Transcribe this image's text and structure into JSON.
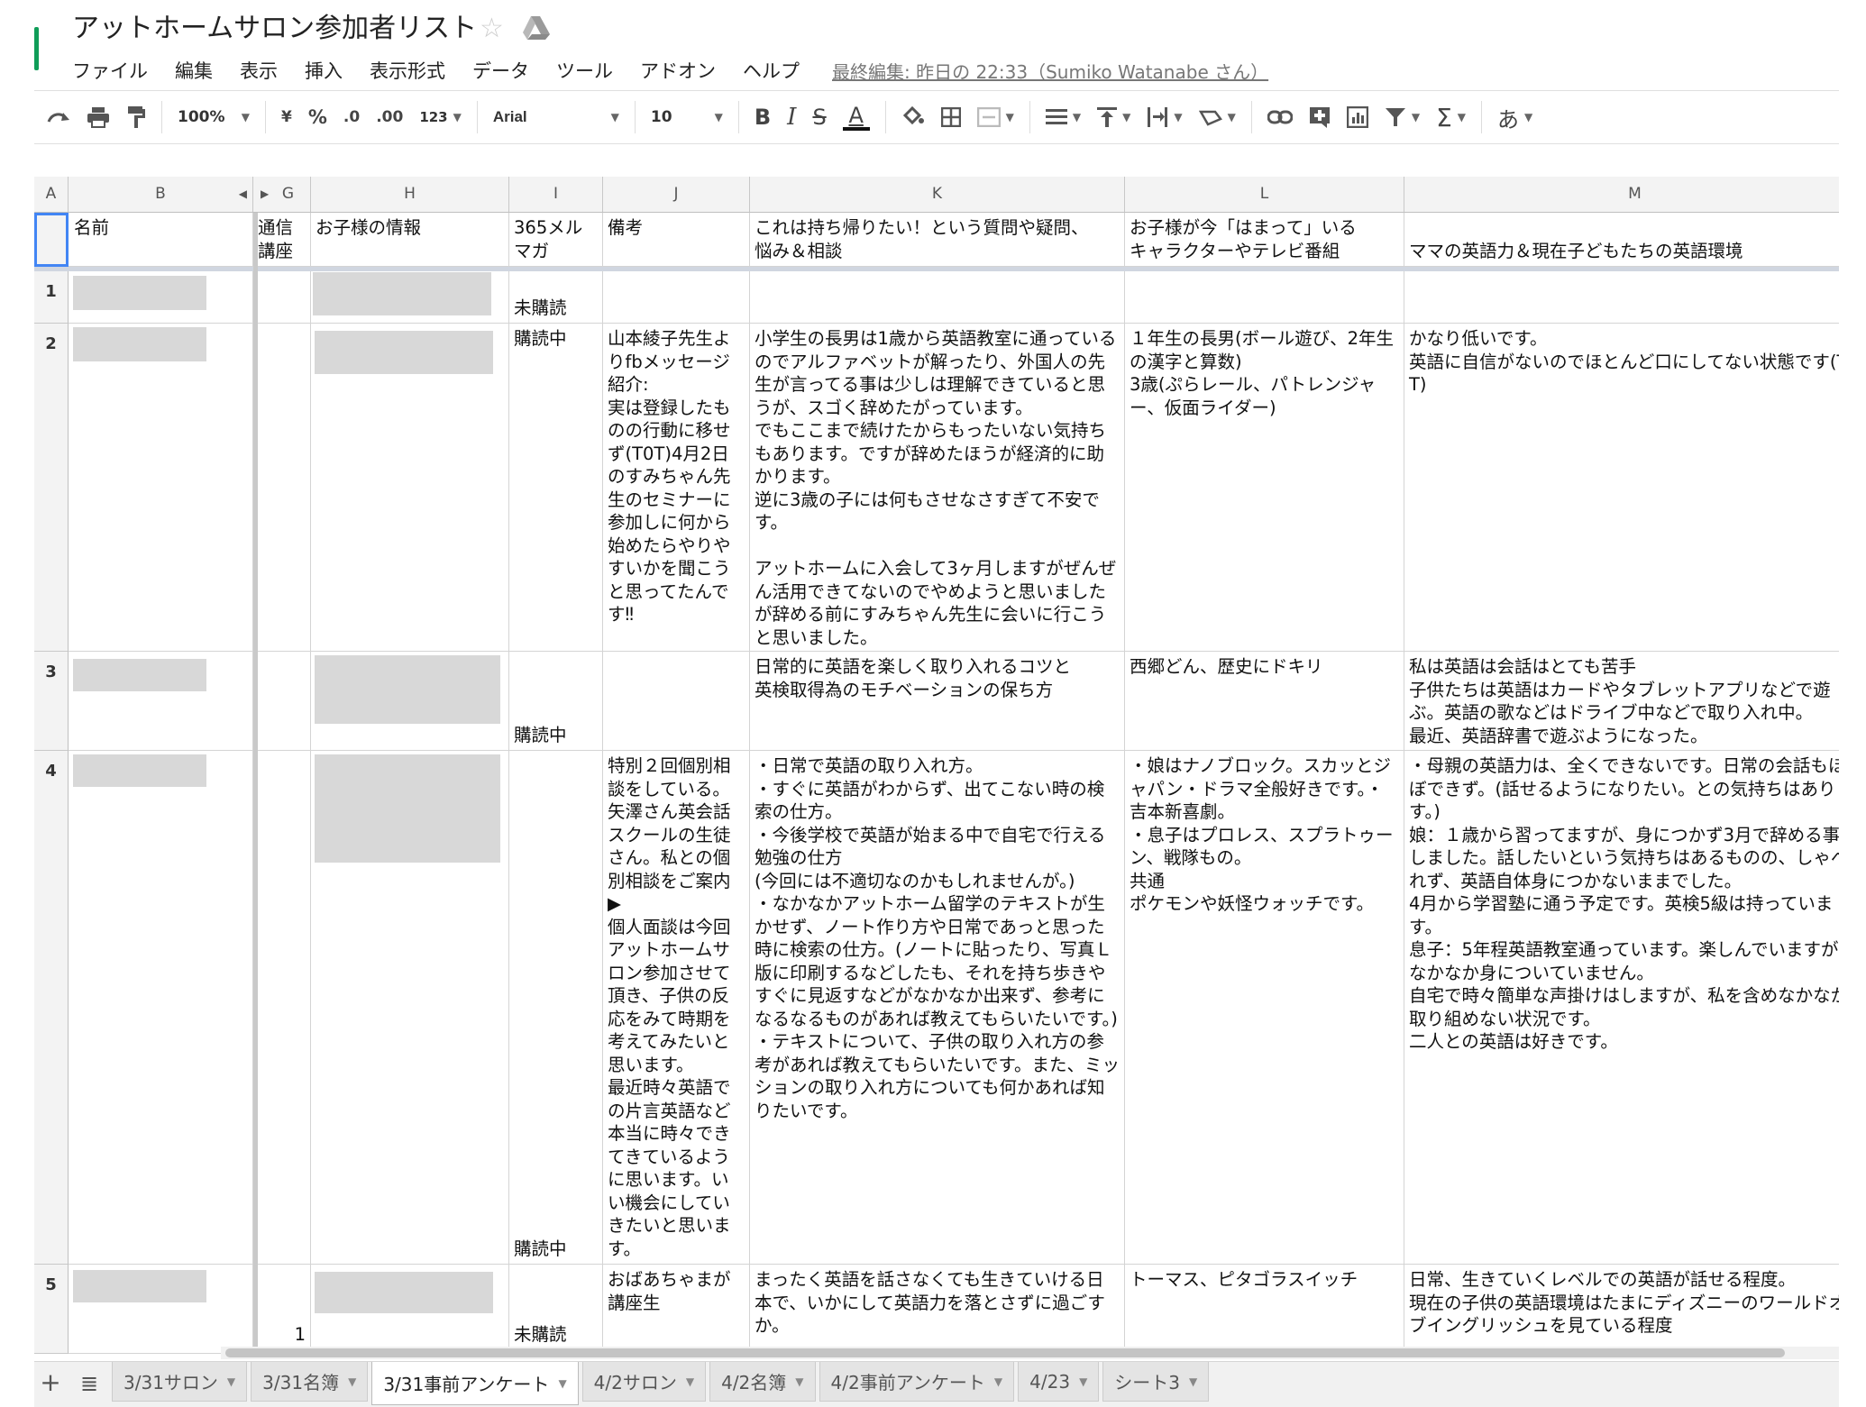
{
  "document": {
    "title": "アットホームサロン参加者リスト",
    "star_icon": "star-icon",
    "drive_icon": "drive-folder-icon",
    "brand_color": "#0f9d58"
  },
  "menu": {
    "items": [
      "ファイル",
      "編集",
      "表示",
      "挿入",
      "表示形式",
      "データ",
      "ツール",
      "アドオン",
      "ヘルプ"
    ],
    "last_edit": "最終編集: 昨日の 22:33（Sumiko Watanabe さん）"
  },
  "toolbar": {
    "zoom": "100%",
    "currency": "¥",
    "percent": "%",
    "decimal_decrease": ".0",
    "decimal_increase": ".00",
    "more_formats": "123",
    "font": "Arial",
    "font_size": "10",
    "bold": "B",
    "italic": "I",
    "strikethrough": "S",
    "text_color": "A",
    "input_tools": "あ",
    "icons": [
      "redo-icon",
      "print-icon",
      "paint-format-icon",
      "fill-color-icon",
      "borders-icon",
      "merge-cells-icon",
      "align-icon",
      "valign-icon",
      "wrap-icon",
      "rotate-icon",
      "link-icon",
      "comment-icon",
      "chart-icon",
      "filter-icon",
      "functions-icon"
    ]
  },
  "columns": [
    {
      "id": "A",
      "label": "A"
    },
    {
      "id": "B",
      "label": "B"
    },
    {
      "id": "G",
      "label": "G"
    },
    {
      "id": "H",
      "label": "H"
    },
    {
      "id": "I",
      "label": "I"
    },
    {
      "id": "J",
      "label": "J"
    },
    {
      "id": "K",
      "label": "K"
    },
    {
      "id": "L",
      "label": "L"
    },
    {
      "id": "M",
      "label": "M"
    }
  ],
  "header_row": {
    "name": "名前",
    "course": "通信\n講座",
    "child_info": "お子様の情報",
    "mailmag": "365メル\nマガ",
    "notes": "備考",
    "questions": "これは持ち帰りたい！という質問や疑問、\n悩み＆相談",
    "character": "お子様が今「はまって」いる\nキャラクターやテレビ番組",
    "english_env": "ママの英語力＆現在子どもたちの英語環境"
  },
  "rows": [
    {
      "num": "1",
      "course": "",
      "mailmag": "未購読",
      "notes": "",
      "questions": "",
      "character": "",
      "english_env": ""
    },
    {
      "num": "2",
      "course": "",
      "mailmag": "購読中",
      "notes": "山本綾子先生よりfbメッセージ紹介:\n実は登録したものの行動に移せず(T0T)4月2日のすみちゃん先生のセミナーに参加しに何から始めたらやりやすいかを聞こうと思ってたんです‼",
      "questions": "小学生の長男は1歳から英語教室に通っているのでアルファベットが解ったり、外国人の先生が言ってる事は少しは理解できていると思うが、スゴく辞めたがっています。\nでもここまで続けたからもったいない気持ちもあります。ですが辞めたほうが経済的に助かります。\n逆に3歳の子には何もさせなさすぎて不安です。\n\nアットホームに入会して3ヶ月しますがぜんぜん活用できてないのでやめようと思いましたが辞める前にすみちゃん先生に会いに行こうと思いました。",
      "character": "１年生の長男(ボール遊び、2年生の漢字と算数)\n3歳(ぷらレール、パトレンジャー、仮面ライダー)",
      "english_env": "かなり低いです。\n英語に自信がないのでほとんど口にしてない状態です(TT)"
    },
    {
      "num": "3",
      "course": "",
      "mailmag": "購読中",
      "notes": "",
      "questions": "日常的に英語を楽しく取り入れるコツと\n英検取得為のモチベーションの保ち方",
      "character": "西郷どん、歴史にドキリ",
      "english_env": "私は英語は会話はとても苦手\n子供たちは英語はカードやタブレットアプリなどで遊ぶ。英語の歌などはドライブ中などで取り入れ中。\n最近、英語辞書で遊ぶようになった。"
    },
    {
      "num": "4",
      "course": "",
      "mailmag": "購読中",
      "notes": "特別２回個別相談をしている。\n矢澤さん英会話スクールの生徒さん。私との個別相談をご案内\n▶\n個人面談は今回アットホームサロン参加させて頂き、子供の反応をみて時期を考えてみたいと思います。\n最近時々英語での片言英語など本当に時々できてきているように思います。いい機会にしていきたいと思います。",
      "questions": "・日常で英語の取り入れ方。\n・すぐに英語がわからず、出てこない時の検索の仕方。\n・今後学校で英語が始まる中で自宅で行える勉強の仕方\n(今回には不適切なのかもしれませんが。)\n・なかなかアットホーム留学のテキストが生かせず、ノート作り方や日常であっと思った時に検索の仕方。(ノートに貼ったり、写真Ｌ版に印刷するなどしたも、それを持ち歩きやすぐに見返すなどがなかなか出来ず、参考になるなるものがあれば教えてもらいたいです。)\n・テキストについて、子供の取り入れ方の参考があれば教えてもらいたいです。また、ミッションの取り入れ方についても何かあれば知りたいです。",
      "character": "・娘はナノブロック。スカッとジャパン・ドラマ全般好きです。・吉本新喜劇。\n・息子はプロレス、スプラトゥーン、戦隊もの。\n共通\nポケモンや妖怪ウォッチです。",
      "english_env": "・母親の英語力は、全くできないです。日常の会話もほぼできず。(話せるようになりたい。との気持ちはあります。)\n娘：１歳から習ってますが、身につかず3月で辞める事にしました。話したいという気持ちはあるものの、しゃべれず、英語自体身につかないままでした。\n4月から学習塾に通う予定です。英検5級は持っています。\n息子：5年程英語教室通っています。楽しんでいますが、なかなか身についていません。\n自宅で時々簡単な声掛けはしますが、私を含めなかなか取り組めない状況です。\n二人との英語は好きです。"
    },
    {
      "num": "5",
      "course": "1",
      "mailmag": "未購読",
      "notes": "おばあちゃまが講座生",
      "questions": "まったく英語を話さなくても生きていける日本で、いかにして英語力を落とさずに過ごすか。",
      "character": "トーマス、ピタゴラスイッチ",
      "english_env": "日常、生きていくレベルでの英語が話せる程度。\n現在の子供の英語環境はたまにディズニーのワールドオブイングリッシュを見ている程度"
    }
  ],
  "sheet_tabs": {
    "add_icon": "plus-icon",
    "list_icon": "sheet-list-icon",
    "tabs": [
      "3/31サロン",
      "3/31名簿",
      "3/31事前アンケート",
      "4/2サロン",
      "4/2名簿",
      "4/2事前アンケート",
      "4/23",
      "シート3"
    ],
    "active_tab": "3/31事前アンケート"
  }
}
